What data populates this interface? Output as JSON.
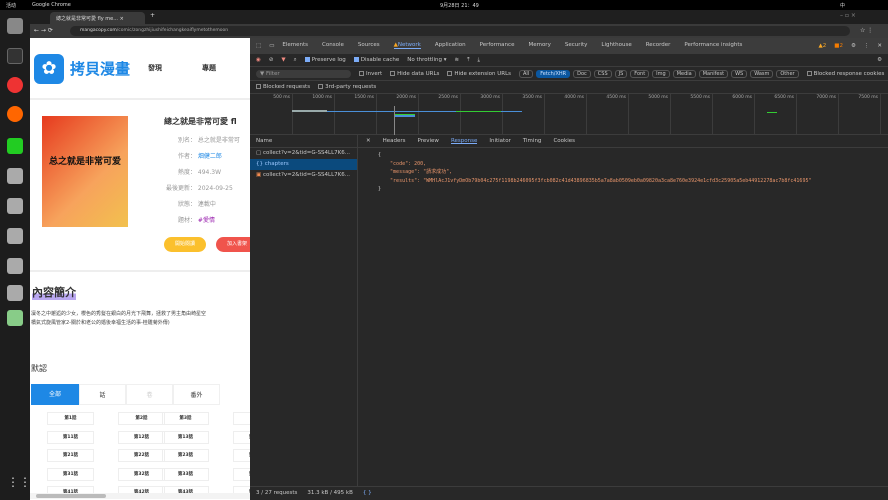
{
  "system": {
    "activities": "活动",
    "app": "Google Chrome",
    "clock": "9月28日 21：49",
    "ime": "中"
  },
  "browser": {
    "tab_title": "總之就是非常可愛 fly me...",
    "url_domain": "mangacopy.com",
    "url_path": "/comic/zongzhijiushifeichangkeaiflymetothemoon"
  },
  "site": {
    "logo": "拷貝漫畫",
    "nav": [
      "發現",
      "專題"
    ]
  },
  "comic": {
    "title": "總之就是非常可愛 fl",
    "fields": [
      {
        "label": "別名：",
        "value": "总之就是非常可"
      },
      {
        "label": "作者：",
        "value": "畑健二郎",
        "link": true
      },
      {
        "label": "熱度：",
        "value": "494.3W"
      },
      {
        "label": "最後更新：",
        "value": "2024-09-25"
      },
      {
        "label": "狀態：",
        "value": "連載中"
      },
      {
        "label": "題材：",
        "value": "#愛情",
        "tag": true
      }
    ],
    "cover_text": "总之就是非常可爱",
    "btn_read": "開始閱讀",
    "btn_shelf": "加入書架",
    "intro_heading": "內容簡介",
    "intro": "凜冬之中邂逅的少女，櫻色的秀髮在銀白的月光下飛舞，拯救了男主角由崎星空\n橋氣式旋風管家2-關於和老公的婚後幸福生活的事-桂雛菊外傳)",
    "group": "默認",
    "tabs": [
      "全部",
      "話",
      "卷",
      "番外"
    ],
    "chapters": [
      "第1話",
      "第2話",
      "第3話",
      "第4話",
      "第11話",
      "第12話",
      "第13話",
      "第14話",
      "第21話",
      "第22話",
      "第23話",
      "第24話",
      "第31話",
      "第32話",
      "第33話",
      "第34話",
      "第41話",
      "第42話",
      "第43話",
      "第44話"
    ]
  },
  "devtools": {
    "tabs": [
      "Elements",
      "Console",
      "Sources",
      "Network",
      "Application",
      "Performance",
      "Memory",
      "Security",
      "Lighthouse",
      "Recorder",
      "Performance insights"
    ],
    "active_tab": "Network",
    "warnings": "2",
    "issues": "2",
    "preserve_log": "Preserve log",
    "disable_cache": "Disable cache",
    "throttling": "No throttling",
    "filter_placeholder": "Filter",
    "invert": "Invert",
    "hide_data": "Hide data URLs",
    "hide_ext": "Hide extension URLs",
    "types": [
      "All",
      "Fetch/XHR",
      "Doc",
      "CSS",
      "JS",
      "Font",
      "Img",
      "Media",
      "Manifest",
      "WS",
      "Wasm",
      "Other"
    ],
    "active_type": "Fetch/XHR",
    "blocked_cookies": "Blocked response cookies",
    "blocked_requests": "Blocked requests",
    "third_party": "3rd-party requests",
    "timeline_ticks": [
      "500 ms",
      "1000 ms",
      "1500 ms",
      "2000 ms",
      "2500 ms",
      "3000 ms",
      "3500 ms",
      "4000 ms",
      "4500 ms",
      "5000 ms",
      "5500 ms",
      "6000 ms",
      "6500 ms",
      "7000 ms",
      "7500 ms"
    ],
    "name_header": "Name",
    "requests": [
      "collect?v=2&tid=G-SS4LL7K6...",
      "chapters",
      "collect?v=2&tid=G-SS4LL7K6..."
    ],
    "selected_request": "chapters",
    "detail_tabs": [
      "Headers",
      "Preview",
      "Response",
      "Initiator",
      "Timing",
      "Cookies"
    ],
    "active_detail": "Response",
    "response_lines": [
      "{",
      "    \"code\": 200,",
      "    \"message\": \"請求成功\",",
      "    \"results\": \"WMHlAcJ1vfyDmOb79b04c275f1198b246095f3fcb082c41d43896835b5a7a8ab0509eb0a09820a3ca8e760e3924e1cfd3c25905a5eb44912278ac7b8fc41695\"",
      "}"
    ],
    "status": "3 / 27 requests",
    "size": "31.3 kB / 495 kB"
  }
}
